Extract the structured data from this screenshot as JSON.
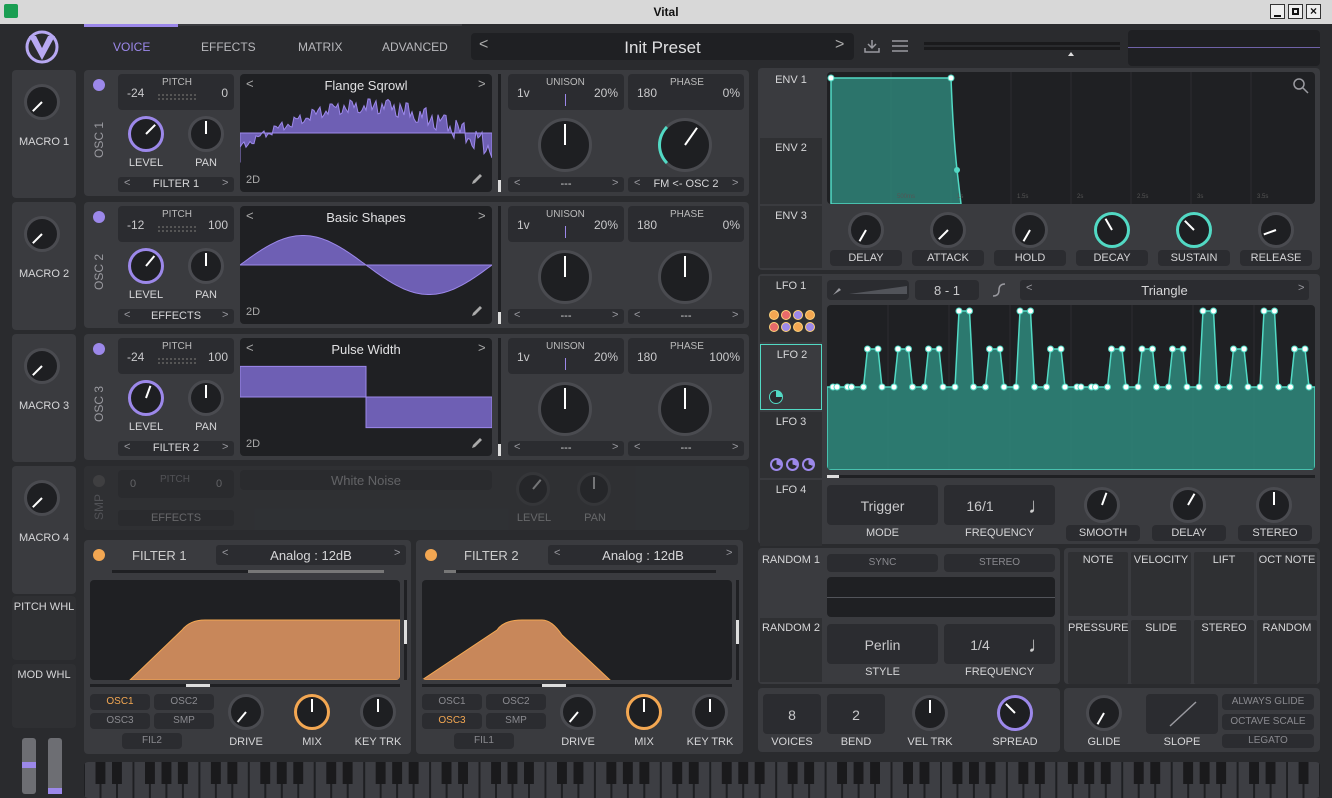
{
  "window": {
    "title": "Vital"
  },
  "nav": {
    "tabs": [
      "VOICE",
      "EFFECTS",
      "MATRIX",
      "ADVANCED"
    ],
    "preset": "Init Preset"
  },
  "macros": [
    "MACRO 1",
    "MACRO 2",
    "MACRO 3",
    "MACRO 4"
  ],
  "wheels": {
    "pitch": "PITCH WHL",
    "mod": "MOD WHL"
  },
  "osc": [
    {
      "label": "OSC 1",
      "pitch_label": "PITCH",
      "pitch_l": "-24",
      "pitch_r": "0",
      "level": "LEVEL",
      "pan": "PAN",
      "dest": "FILTER 1",
      "wave": "Flange Sqrowl",
      "dim": "2D",
      "unison": "UNISON",
      "uni_v": "1v",
      "uni_pct": "20%",
      "phase": "PHASE",
      "ph_v": "180",
      "ph_pct": "0%",
      "sel1": "---",
      "sel2": "FM <- OSC 2"
    },
    {
      "label": "OSC 2",
      "pitch_label": "PITCH",
      "pitch_l": "-12",
      "pitch_r": "100",
      "level": "LEVEL",
      "pan": "PAN",
      "dest": "EFFECTS",
      "wave": "Basic Shapes",
      "dim": "2D",
      "unison": "UNISON",
      "uni_v": "1v",
      "uni_pct": "20%",
      "phase": "PHASE",
      "ph_v": "180",
      "ph_pct": "0%",
      "sel1": "---",
      "sel2": "---"
    },
    {
      "label": "OSC 3",
      "pitch_label": "PITCH",
      "pitch_l": "-24",
      "pitch_r": "100",
      "level": "LEVEL",
      "pan": "PAN",
      "dest": "FILTER 2",
      "wave": "Pulse Width",
      "dim": "2D",
      "unison": "UNISON",
      "uni_v": "1v",
      "uni_pct": "20%",
      "phase": "PHASE",
      "ph_v": "180",
      "ph_pct": "100%",
      "sel1": "---",
      "sel2": "---"
    }
  ],
  "smp": {
    "label": "SMP",
    "pitch": "PITCH",
    "pitch_l": "0",
    "pitch_r": "0",
    "dest": "EFFECTS",
    "wave": "White Noise",
    "level": "LEVEL",
    "pan": "PAN"
  },
  "filters": [
    {
      "title": "FILTER 1",
      "type": "Analog : 12dB",
      "src": [
        "OSC1",
        "OSC2",
        "OSC3",
        "SMP"
      ],
      "fil": "FIL2",
      "drive": "DRIVE",
      "mix": "MIX",
      "keytrk": "KEY TRK"
    },
    {
      "title": "FILTER 2",
      "type": "Analog : 12dB",
      "src": [
        "OSC1",
        "OSC2",
        "OSC3",
        "SMP"
      ],
      "fil": "FIL1",
      "drive": "DRIVE",
      "mix": "MIX",
      "keytrk": "KEY TRK"
    }
  ],
  "env": {
    "tabs": [
      "ENV 1",
      "ENV 2",
      "ENV 3"
    ],
    "knobs": [
      "DELAY",
      "ATTACK",
      "HOLD",
      "DECAY",
      "SUSTAIN",
      "RELEASE"
    ],
    "ticks": [
      "500ms",
      "1s",
      "1.5s",
      "2s",
      "2.5s",
      "3s",
      "3.5s"
    ]
  },
  "lfo": {
    "tabs": [
      "LFO 1",
      "LFO 2",
      "LFO 3",
      "LFO 4"
    ],
    "grid": "8 - 1",
    "shape": "Triangle",
    "mode": "Trigger",
    "mode_label": "MODE",
    "freq": "16/1",
    "freq_label": "FREQUENCY",
    "smooth": "SMOOTH",
    "delay": "DELAY",
    "stereo": "STEREO"
  },
  "random": {
    "tabs": [
      "RANDOM 1",
      "RANDOM 2"
    ],
    "sync": "SYNC",
    "stereo": "STEREO",
    "style": "Perlin",
    "style_label": "STYLE",
    "freq": "1/4",
    "freq_label": "FREQUENCY"
  },
  "mod_sources": [
    "NOTE",
    "VELOCITY",
    "LIFT",
    "OCT NOTE",
    "PRESSURE",
    "SLIDE",
    "STEREO",
    "RANDOM"
  ],
  "voice": {
    "voices": "8",
    "voices_label": "VOICES",
    "bend": "2",
    "bend_label": "BEND",
    "veltrk": "VEL TRK",
    "spread": "SPREAD"
  },
  "glide": {
    "glide": "GLIDE",
    "slope": "SLOPE",
    "always": "ALWAYS GLIDE",
    "octave": "OCTAVE SCALE",
    "legato": "LEGATO"
  },
  "colors": {
    "accent": "#9c88ea",
    "teal": "#52d9c4",
    "orange": "#f3a752"
  }
}
